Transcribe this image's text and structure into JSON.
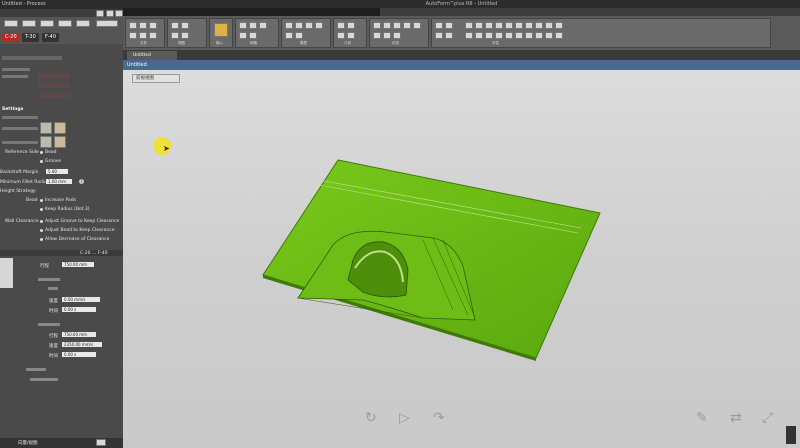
{
  "app": {
    "title": "AutoForm^plus R8 - Untitled"
  },
  "left_panel": {
    "title": "Untitled - Process",
    "tabs": [
      "C-20",
      "T-30",
      "F-40"
    ],
    "red_values": [
      "·",
      "·",
      "·"
    ],
    "section_settings": "Settings",
    "reference_side_label": "Reference Side",
    "reference_side_options": [
      "Bead",
      "Groove"
    ],
    "backdraft_label": "Backdraft Margin",
    "backdraft_value": "5.00",
    "fillet_label": "Minimum Fillet Radius",
    "fillet_value": "1.00 mm",
    "strategy_label": "Height Strategy",
    "bead_label": "Bead",
    "bead_options": [
      "Increase Pads",
      "Keep Radius (Bot.3)"
    ],
    "wall_label": "Wall Clearance",
    "wall_options": [
      "Adjust Groove to Keep Clearance",
      "Adjust Bead to Keep Clearance",
      "Allow Decrease of Clearance"
    ],
    "stage_header": "C-20 ... F-40",
    "form_fields": [
      {
        "label": "行程",
        "value": "750.00 mm"
      },
      {
        "label": "速度",
        "value": "0.00 mm/s"
      },
      {
        "label": "时间",
        "value": "0.00 s"
      },
      {
        "label": "行程",
        "value": "750.00 mm"
      },
      {
        "label": "速度",
        "value": "2350.00 mm/s"
      },
      {
        "label": "时间",
        "value": "0.00 s"
      }
    ],
    "footer_label": "向量/视图"
  },
  "ribbon": {
    "groups": [
      "文件",
      "视图",
      "输入",
      "网格",
      "模型",
      "几何",
      "仿真",
      "评估"
    ]
  },
  "document": {
    "tab": "Untitled",
    "viewport_title": "Untitled",
    "view_dropdown": "前视视图"
  },
  "colors": {
    "part": "#6bbf14",
    "part_dark": "#3f7a08",
    "cursor": "#f2e21a",
    "tab_red": "#b02a2a"
  }
}
